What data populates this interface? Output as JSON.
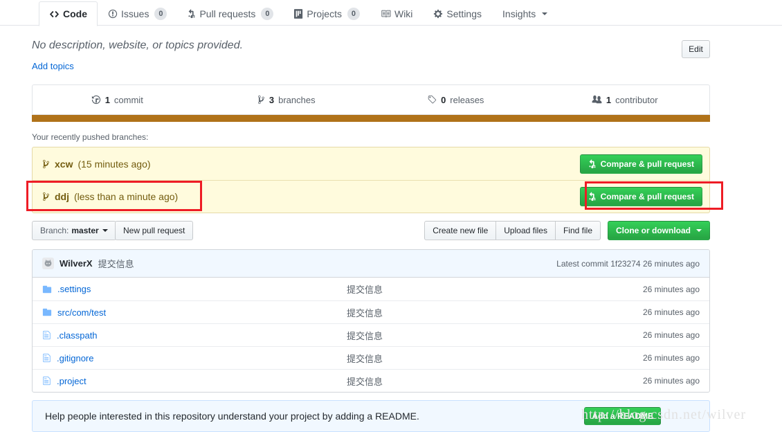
{
  "tabs": [
    {
      "id": "code",
      "label": "Code",
      "icon": "code-icon",
      "count": null,
      "selected": true
    },
    {
      "id": "issues",
      "label": "Issues",
      "icon": "issue-opened-icon",
      "count": "0",
      "selected": false
    },
    {
      "id": "pull-requests",
      "label": "Pull requests",
      "icon": "git-pull-request-icon",
      "count": "0",
      "selected": false
    },
    {
      "id": "projects",
      "label": "Projects",
      "icon": "project-icon",
      "count": "0",
      "selected": false
    },
    {
      "id": "wiki",
      "label": "Wiki",
      "icon": "book-icon",
      "count": null,
      "selected": false
    },
    {
      "id": "settings",
      "label": "Settings",
      "icon": "gear-icon",
      "count": null,
      "selected": false
    },
    {
      "id": "insights",
      "label": "Insights",
      "icon": "none",
      "count": null,
      "selected": false,
      "caret": true
    }
  ],
  "description": {
    "text": "No description, website, or topics provided.",
    "add_topics_label": "Add topics",
    "edit_label": "Edit"
  },
  "stats": [
    {
      "id": "commits",
      "value": "1",
      "label": "commit",
      "icon": "history-icon"
    },
    {
      "id": "branches",
      "value": "3",
      "label": "branches",
      "icon": "git-branch-icon"
    },
    {
      "id": "releases",
      "value": "0",
      "label": "releases",
      "icon": "tag-icon"
    },
    {
      "id": "contributors",
      "value": "1",
      "label": "contributor",
      "icon": "organization-icon"
    }
  ],
  "language_bar": {
    "color": "#b07219"
  },
  "pushed_branches": {
    "label": "Your recently pushed branches:",
    "rows": [
      {
        "name": "xcw",
        "age": "(15 minutes ago)",
        "button": "Compare & pull request",
        "highlighted": false
      },
      {
        "name": "ddj",
        "age": "(less than a minute ago)",
        "button": "Compare & pull request",
        "highlighted": true
      }
    ]
  },
  "toolbar": {
    "branch_prefix": "Branch:",
    "branch_name": "master",
    "new_pull_request": "New pull request",
    "create_new_file": "Create new file",
    "upload_files": "Upload files",
    "find_file": "Find file",
    "clone_or_download": "Clone or download"
  },
  "commit_header": {
    "author": "WilverX",
    "message": "提交信息",
    "latest_label": "Latest commit",
    "hash": "1f23274",
    "age": "26 minutes ago"
  },
  "files": [
    {
      "name": ".settings",
      "type": "folder",
      "message": "提交信息",
      "age": "26 minutes ago"
    },
    {
      "name": "src/com/test",
      "type": "folder",
      "message": "提交信息",
      "age": "26 minutes ago"
    },
    {
      "name": ".classpath",
      "type": "file",
      "message": "提交信息",
      "age": "26 minutes ago"
    },
    {
      "name": ".gitignore",
      "type": "file",
      "message": "提交信息",
      "age": "26 minutes ago"
    },
    {
      "name": ".project",
      "type": "file",
      "message": "提交信息",
      "age": "26 minutes ago"
    }
  ],
  "readme_prompt": {
    "text": "Help people interested in this repository understand your project by adding a README.",
    "button": "Add a README"
  },
  "watermark": "http://blog.csdn.net/wilver",
  "annotation_color": "#ee1c25"
}
